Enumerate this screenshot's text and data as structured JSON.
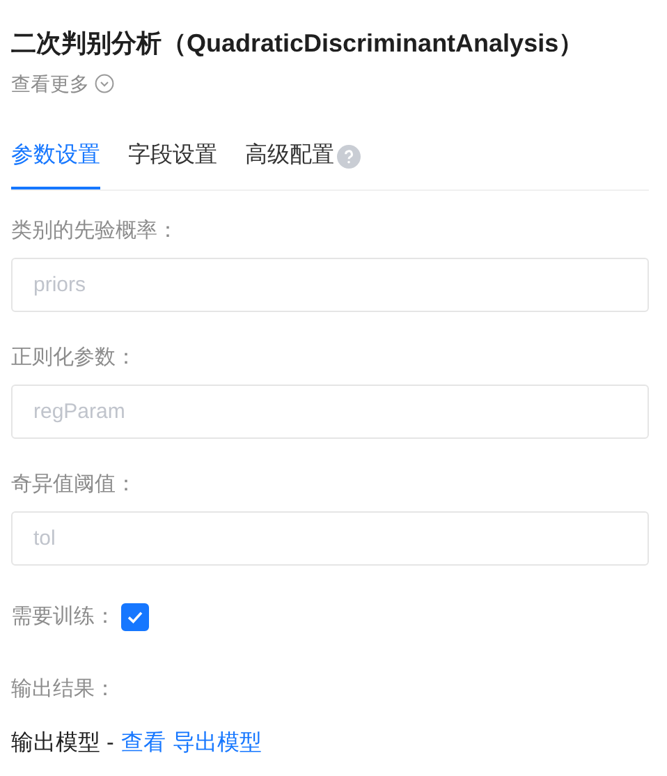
{
  "title": "二次判别分析（QuadraticDiscriminantAnalysis）",
  "more_link": "查看更多",
  "tabs": [
    {
      "label": "参数设置",
      "selected": true,
      "help": false
    },
    {
      "label": "字段设置",
      "selected": false,
      "help": false
    },
    {
      "label": "高级配置",
      "selected": false,
      "help": true
    }
  ],
  "fields": [
    {
      "kind": "input",
      "label": "类别的先验概率：",
      "placeholder": "priors"
    },
    {
      "kind": "input",
      "label": "正则化参数：",
      "placeholder": "regParam"
    },
    {
      "kind": "input",
      "label": "奇异值阈值：",
      "placeholder": "tol"
    },
    {
      "kind": "checkbox",
      "label": "需要训练：",
      "checked": true
    }
  ],
  "output": {
    "label": "输出结果：",
    "text": "输出模型 -",
    "links": [
      "查看",
      "导出模型"
    ]
  }
}
